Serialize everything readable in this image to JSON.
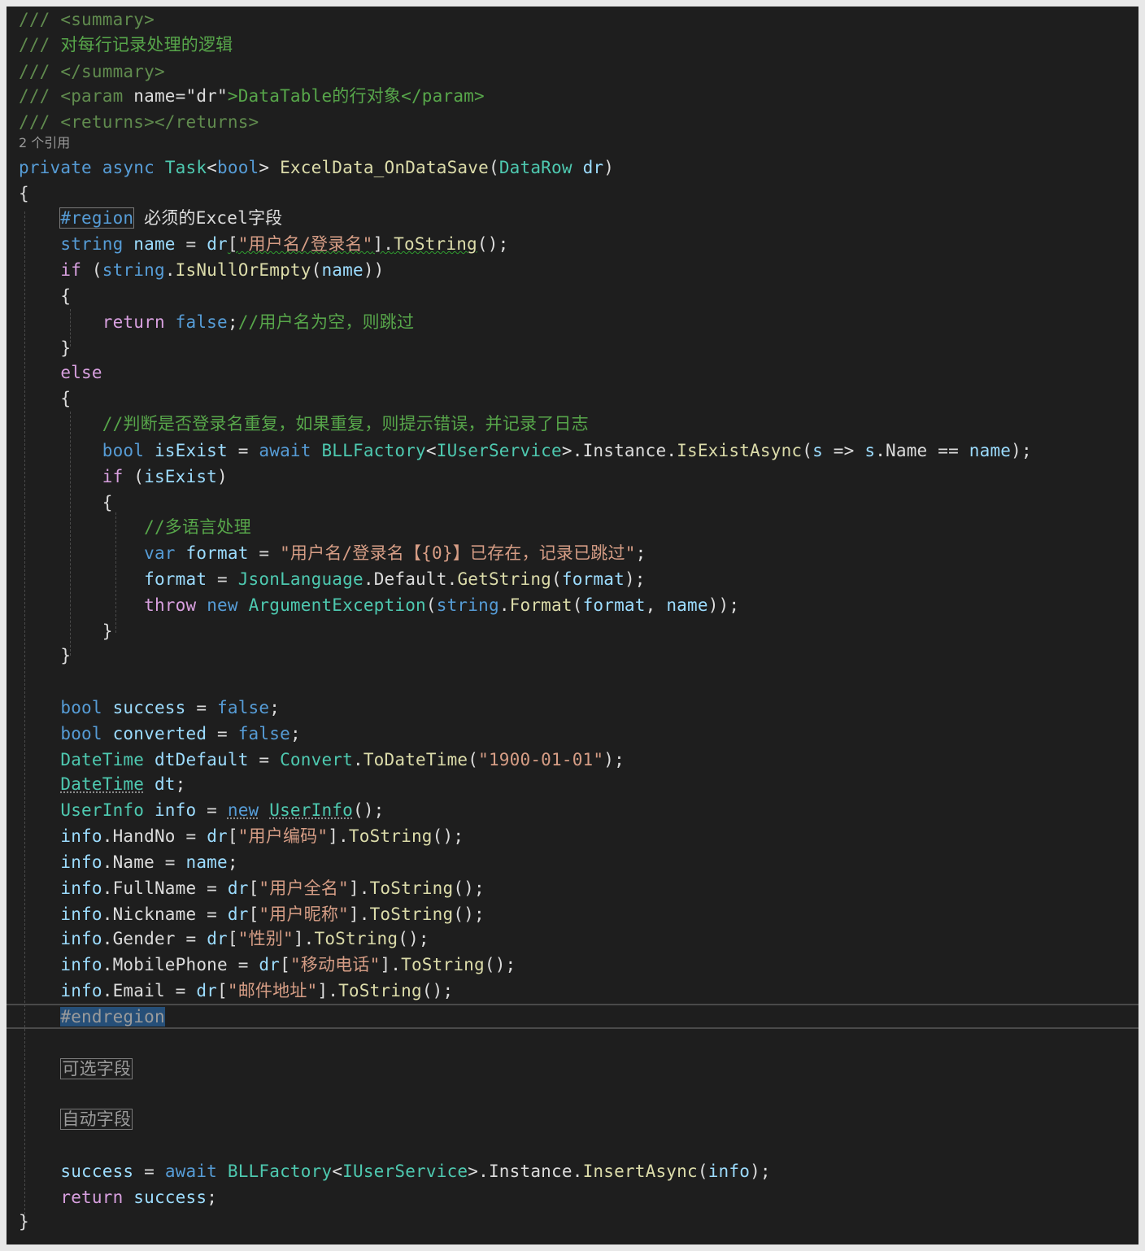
{
  "editor": {
    "doc": [
      "/// ",
      "<summary>"
    ],
    "doc2": [
      "/// ",
      "对每行记录处理的逻辑"
    ],
    "doc3": [
      "/// ",
      "</summary>"
    ],
    "doc4": [
      "/// ",
      "<param ",
      "name=",
      "\"dr\"",
      ">DataTable的行对象</param>"
    ],
    "doc5": [
      "/// ",
      "<returns></returns>"
    ],
    "codelens": "2 个引用",
    "signature": [
      "private",
      " ",
      "async",
      " ",
      "Task",
      "<",
      "bool",
      "> ",
      "ExcelData_OnDataSave",
      "(",
      "DataRow",
      " ",
      "dr",
      ")"
    ],
    "open_brace": "{",
    "region": [
      "#region",
      " 必须的Excel字段"
    ],
    "name_line": [
      "string",
      " ",
      "name",
      " = ",
      "dr",
      "[",
      "\"用户名/登录名\"",
      "].",
      "ToString",
      "();"
    ],
    "if_line": [
      "if",
      " (",
      "string",
      ".",
      "IsNullOrEmpty",
      "(",
      "name",
      "))"
    ],
    "brace_open_1": "{",
    "return_false": [
      "return",
      " ",
      "false",
      ";",
      "//用户名为空，则跳过"
    ],
    "brace_close_1": "}",
    "else": "else",
    "brace_open_2": "{",
    "comment_exist": "//判断是否登录名重复，如果重复，则提示错误，并记录了日志",
    "isexist_line": [
      "bool",
      " ",
      "isExist",
      " = ",
      "await",
      " ",
      "BLLFactory",
      "<",
      "IUserService",
      ">.",
      "Instance",
      ".",
      "IsExistAsync",
      "(",
      "s",
      " => ",
      "s",
      ".",
      "Name",
      " == ",
      "name",
      ");"
    ],
    "if_exist": [
      "if",
      " (",
      "isExist",
      ")"
    ],
    "brace_open_3": "{",
    "comment_lang": "//多语言处理",
    "format_line": [
      "var",
      " ",
      "format",
      " = ",
      "\"用户名/登录名【{0}】已存在，记录已跳过\"",
      ";"
    ],
    "getstring_line": [
      "format",
      " = ",
      "JsonLanguage",
      ".",
      "Default",
      ".",
      "GetString",
      "(",
      "format",
      ");"
    ],
    "throw_line": [
      "throw",
      " ",
      "new",
      " ",
      "ArgumentException",
      "(",
      "string",
      ".",
      "Format",
      "(",
      "format",
      ", ",
      "name",
      "));"
    ],
    "brace_close_3": "}",
    "brace_close_2": "}",
    "success_line": [
      "bool",
      " ",
      "success",
      " = ",
      "false",
      ";"
    ],
    "converted_line": [
      "bool",
      " ",
      "converted",
      " = ",
      "false",
      ";"
    ],
    "dtdefault_line": [
      "DateTime",
      " ",
      "dtDefault",
      " = ",
      "Convert",
      ".",
      "ToDateTime",
      "(",
      "\"1900-01-01\"",
      ");"
    ],
    "dt_line": [
      "DateTime",
      " ",
      "dt",
      ";"
    ],
    "info_line": [
      "UserInfo",
      " ",
      "info",
      " = ",
      "new",
      " ",
      "UserInfo",
      "();"
    ],
    "handno_line": [
      "info",
      ".",
      "HandNo",
      " = ",
      "dr",
      "[",
      "\"用户编码\"",
      "].",
      "ToString",
      "();"
    ],
    "infoname_line": [
      "info",
      ".",
      "Name",
      " = ",
      "name",
      ";"
    ],
    "fullname_line": [
      "info",
      ".",
      "FullName",
      " = ",
      "dr",
      "[",
      "\"用户全名\"",
      "].",
      "ToString",
      "();"
    ],
    "nickname_line": [
      "info",
      ".",
      "Nickname",
      " = ",
      "dr",
      "[",
      "\"用户昵称\"",
      "].",
      "ToString",
      "();"
    ],
    "gender_line": [
      "info",
      ".",
      "Gender",
      " = ",
      "dr",
      "[",
      "\"性别\"",
      "].",
      "ToString",
      "();"
    ],
    "mobile_line": [
      "info",
      ".",
      "MobilePhone",
      " = ",
      "dr",
      "[",
      "\"移动电话\"",
      "].",
      "ToString",
      "();"
    ],
    "email_line": [
      "info",
      ".",
      "Email",
      " = ",
      "dr",
      "[",
      "\"邮件地址\"",
      "].",
      "ToString",
      "();"
    ],
    "endregion": "#endregion",
    "collapsed_optional": "可选字段",
    "collapsed_auto": "自动字段",
    "insert_line": [
      "success",
      " = ",
      "await",
      " ",
      "BLLFactory",
      "<",
      "IUserService",
      ">.",
      "Instance",
      ".",
      "InsertAsync",
      "(",
      "info",
      ");"
    ],
    "return_success": [
      "return",
      " ",
      "success",
      ";"
    ],
    "close_brace": "}"
  },
  "colors": {
    "background": "#1e1e1e",
    "comment": "#57a64a",
    "keyword": "#569cd6",
    "control_keyword": "#d8a0df",
    "type": "#4ec9b0",
    "string": "#d69d85",
    "method": "#dcdcaa",
    "variable": "#9cdcfe",
    "selection": "#264f78"
  }
}
